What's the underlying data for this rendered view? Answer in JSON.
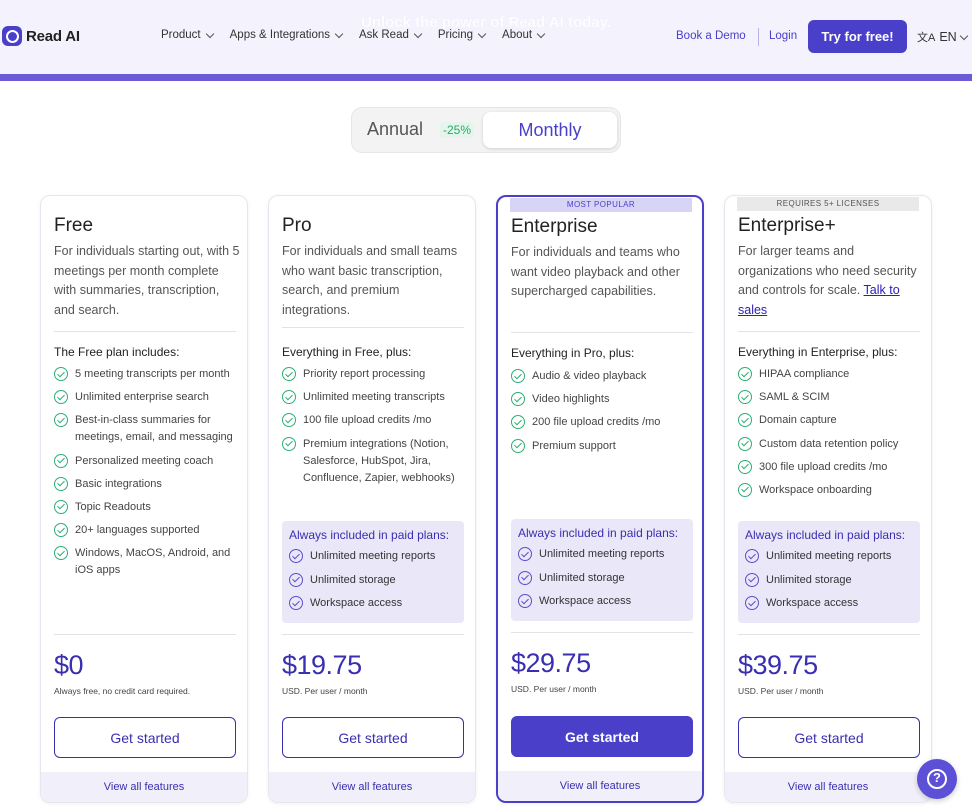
{
  "header": {
    "promo": "Unlock the power of Read AI today.",
    "logo_text": "Read AI",
    "nav": [
      "Product",
      "Apps & Integrations",
      "Ask Read",
      "Pricing",
      "About"
    ],
    "book_demo": "Book a Demo",
    "login": "Login",
    "try_free": "Try for free!",
    "lang": "EN"
  },
  "toggle": {
    "annual": "Annual",
    "discount": "-25%",
    "monthly": "Monthly",
    "selected": "Monthly"
  },
  "plans": [
    {
      "name": "Free",
      "desc": "For individuals starting out, with 5 meetings per month complete with summaries, transcription, and search.",
      "includes": "The Free plan includes:",
      "features": [
        "5 meeting transcripts per month",
        "Unlimited enterprise search",
        "Best-in-class summaries for meetings, email, and messaging",
        "Personalized meeting coach",
        "Basic integrations",
        "Topic Readouts",
        "20+ languages supported",
        "Windows, MacOS, Android, and iOS apps"
      ],
      "price": "$0",
      "price_note": "Always free, no credit card required.",
      "cta": "Get started",
      "view_all": "View all features"
    },
    {
      "name": "Pro",
      "desc": "For individuals and small teams who want basic transcription, search, and premium integrations.",
      "includes": "Everything in Free, plus:",
      "features": [
        "Priority report processing",
        "Unlimited meeting transcripts",
        "100 file upload credits /mo",
        "Premium integrations (Notion, Salesforce, HubSpot, Jira, Confluence, Zapier, webhooks)"
      ],
      "paid_title": "Always included in paid plans:",
      "paid_features": [
        "Unlimited meeting reports",
        "Unlimited storage",
        "Workspace access"
      ],
      "price": "$19.75",
      "price_note": "USD. Per user / month",
      "cta": "Get started",
      "view_all": "View all features"
    },
    {
      "ribbon": "MOST POPULAR",
      "name": "Enterprise",
      "desc": "For individuals and teams who want video playback and other supercharged capabilities.",
      "includes": "Everything in Pro, plus:",
      "features": [
        "Audio & video playback",
        "Video highlights",
        "200 file upload credits /mo",
        "Premium support"
      ],
      "paid_title": "Always included in paid plans:",
      "paid_features": [
        "Unlimited meeting reports",
        "Unlimited storage",
        "Workspace access"
      ],
      "price": "$29.75",
      "price_note": "USD. Per user / month",
      "cta": "Get started",
      "view_all": "View all features"
    },
    {
      "ribbon": "REQUIRES 5+ LICENSES",
      "name": "Enterprise+",
      "desc": "For larger teams and organizations who need security and controls for scale.",
      "desc_link": "Talk to sales",
      "includes": "Everything in Enterprise, plus:",
      "features": [
        "HIPAA compliance",
        "SAML & SCIM",
        "Domain capture",
        "Custom data retention policy",
        "300 file upload credits /mo",
        "Workspace onboarding"
      ],
      "paid_title": "Always included in paid plans:",
      "paid_features": [
        "Unlimited meeting reports",
        "Unlimited storage",
        "Workspace access"
      ],
      "price": "$39.75",
      "price_note": "USD. Per user / month",
      "cta": "Get started",
      "view_all": "View all features"
    }
  ],
  "help": "?"
}
